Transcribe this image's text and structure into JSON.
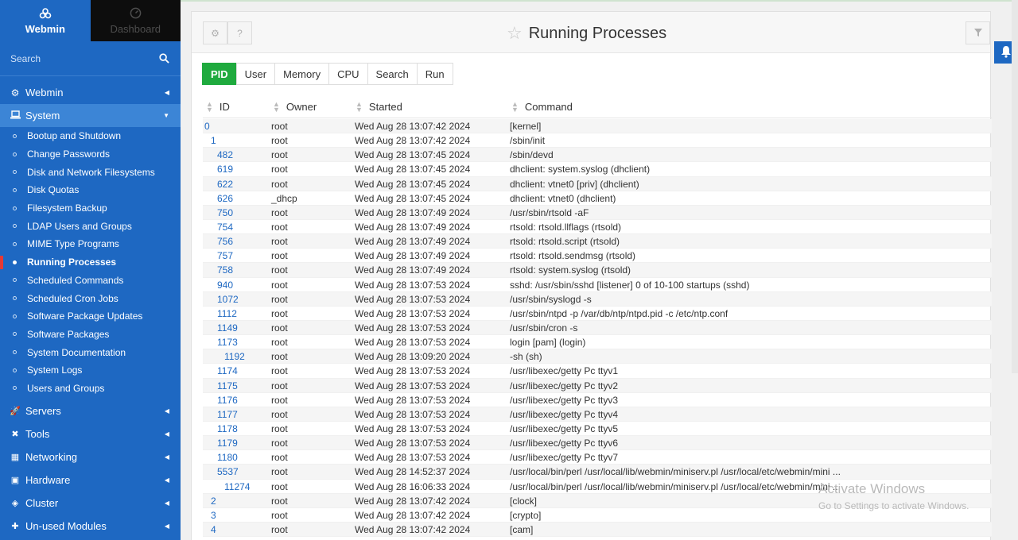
{
  "sidebar": {
    "tab_webmin": "Webmin",
    "tab_dashboard": "Dashboard",
    "search_placeholder": "Search",
    "categories_top": [
      {
        "label": "Webmin"
      },
      {
        "label": "System"
      }
    ],
    "system_items": [
      "Bootup and Shutdown",
      "Change Passwords",
      "Disk and Network Filesystems",
      "Disk Quotas",
      "Filesystem Backup",
      "LDAP Users and Groups",
      "MIME Type Programs",
      "Running Processes",
      "Scheduled Commands",
      "Scheduled Cron Jobs",
      "Software Package Updates",
      "Software Packages",
      "System Documentation",
      "System Logs",
      "Users and Groups"
    ],
    "active_item": "Running Processes",
    "categories_bottom": [
      {
        "label": "Servers",
        "icon": "rocket-icon"
      },
      {
        "label": "Tools",
        "icon": "wrench-icon"
      },
      {
        "label": "Networking",
        "icon": "network-icon"
      },
      {
        "label": "Hardware",
        "icon": "hdd-icon"
      },
      {
        "label": "Cluster",
        "icon": "layers-icon"
      },
      {
        "label": "Un-used Modules",
        "icon": "puzzle-icon"
      }
    ]
  },
  "header": {
    "title": "Running Processes"
  },
  "tabs": [
    "PID",
    "User",
    "Memory",
    "CPU",
    "Search",
    "Run"
  ],
  "active_tab": "PID",
  "table": {
    "columns": [
      "ID",
      "Owner",
      "Started",
      "Command"
    ],
    "rows": [
      {
        "id": "0",
        "indent": 0,
        "owner": "root",
        "started": "Wed Aug 28 13:07:42 2024",
        "command": "[kernel]"
      },
      {
        "id": "1",
        "indent": 1,
        "owner": "root",
        "started": "Wed Aug 28 13:07:42 2024",
        "command": "/sbin/init"
      },
      {
        "id": "482",
        "indent": 2,
        "owner": "root",
        "started": "Wed Aug 28 13:07:45 2024",
        "command": "/sbin/devd"
      },
      {
        "id": "619",
        "indent": 2,
        "owner": "root",
        "started": "Wed Aug 28 13:07:45 2024",
        "command": "dhclient: system.syslog (dhclient)"
      },
      {
        "id": "622",
        "indent": 2,
        "owner": "root",
        "started": "Wed Aug 28 13:07:45 2024",
        "command": "dhclient: vtnet0 [priv] (dhclient)"
      },
      {
        "id": "626",
        "indent": 2,
        "owner": "_dhcp",
        "started": "Wed Aug 28 13:07:45 2024",
        "command": "dhclient: vtnet0 (dhclient)"
      },
      {
        "id": "750",
        "indent": 2,
        "owner": "root",
        "started": "Wed Aug 28 13:07:49 2024",
        "command": "/usr/sbin/rtsold -aF"
      },
      {
        "id": "754",
        "indent": 2,
        "owner": "root",
        "started": "Wed Aug 28 13:07:49 2024",
        "command": "rtsold: rtsold.llflags (rtsold)"
      },
      {
        "id": "756",
        "indent": 2,
        "owner": "root",
        "started": "Wed Aug 28 13:07:49 2024",
        "command": "rtsold: rtsold.script (rtsold)"
      },
      {
        "id": "757",
        "indent": 2,
        "owner": "root",
        "started": "Wed Aug 28 13:07:49 2024",
        "command": "rtsold: rtsold.sendmsg (rtsold)"
      },
      {
        "id": "758",
        "indent": 2,
        "owner": "root",
        "started": "Wed Aug 28 13:07:49 2024",
        "command": "rtsold: system.syslog (rtsold)"
      },
      {
        "id": "940",
        "indent": 2,
        "owner": "root",
        "started": "Wed Aug 28 13:07:53 2024",
        "command": "sshd: /usr/sbin/sshd [listener] 0 of 10-100 startups (sshd)"
      },
      {
        "id": "1072",
        "indent": 2,
        "owner": "root",
        "started": "Wed Aug 28 13:07:53 2024",
        "command": "/usr/sbin/syslogd -s"
      },
      {
        "id": "1112",
        "indent": 2,
        "owner": "root",
        "started": "Wed Aug 28 13:07:53 2024",
        "command": "/usr/sbin/ntpd -p /var/db/ntp/ntpd.pid -c /etc/ntp.conf"
      },
      {
        "id": "1149",
        "indent": 2,
        "owner": "root",
        "started": "Wed Aug 28 13:07:53 2024",
        "command": "/usr/sbin/cron -s"
      },
      {
        "id": "1173",
        "indent": 2,
        "owner": "root",
        "started": "Wed Aug 28 13:07:53 2024",
        "command": "login [pam] (login)"
      },
      {
        "id": "1192",
        "indent": 3,
        "owner": "root",
        "started": "Wed Aug 28 13:09:20 2024",
        "command": "-sh (sh)"
      },
      {
        "id": "1174",
        "indent": 2,
        "owner": "root",
        "started": "Wed Aug 28 13:07:53 2024",
        "command": "/usr/libexec/getty Pc ttyv1"
      },
      {
        "id": "1175",
        "indent": 2,
        "owner": "root",
        "started": "Wed Aug 28 13:07:53 2024",
        "command": "/usr/libexec/getty Pc ttyv2"
      },
      {
        "id": "1176",
        "indent": 2,
        "owner": "root",
        "started": "Wed Aug 28 13:07:53 2024",
        "command": "/usr/libexec/getty Pc ttyv3"
      },
      {
        "id": "1177",
        "indent": 2,
        "owner": "root",
        "started": "Wed Aug 28 13:07:53 2024",
        "command": "/usr/libexec/getty Pc ttyv4"
      },
      {
        "id": "1178",
        "indent": 2,
        "owner": "root",
        "started": "Wed Aug 28 13:07:53 2024",
        "command": "/usr/libexec/getty Pc ttyv5"
      },
      {
        "id": "1179",
        "indent": 2,
        "owner": "root",
        "started": "Wed Aug 28 13:07:53 2024",
        "command": "/usr/libexec/getty Pc ttyv6"
      },
      {
        "id": "1180",
        "indent": 2,
        "owner": "root",
        "started": "Wed Aug 28 13:07:53 2024",
        "command": "/usr/libexec/getty Pc ttyv7"
      },
      {
        "id": "5537",
        "indent": 2,
        "owner": "root",
        "started": "Wed Aug 28 14:52:37 2024",
        "command": "/usr/local/bin/perl /usr/local/lib/webmin/miniserv.pl /usr/local/etc/webmin/mini ..."
      },
      {
        "id": "11274",
        "indent": 3,
        "owner": "root",
        "started": "Wed Aug 28 16:06:33 2024",
        "command": "/usr/local/bin/perl /usr/local/lib/webmin/miniserv.pl /usr/local/etc/webmin/mini ..."
      },
      {
        "id": "2",
        "indent": 1,
        "owner": "root",
        "started": "Wed Aug 28 13:07:42 2024",
        "command": "[clock]"
      },
      {
        "id": "3",
        "indent": 1,
        "owner": "root",
        "started": "Wed Aug 28 13:07:42 2024",
        "command": "[crypto]"
      },
      {
        "id": "4",
        "indent": 1,
        "owner": "root",
        "started": "Wed Aug 28 13:07:42 2024",
        "command": "[cam]"
      }
    ]
  },
  "watermark": {
    "line1": "Activate Windows",
    "line2": "Go to Settings to activate Windows."
  }
}
